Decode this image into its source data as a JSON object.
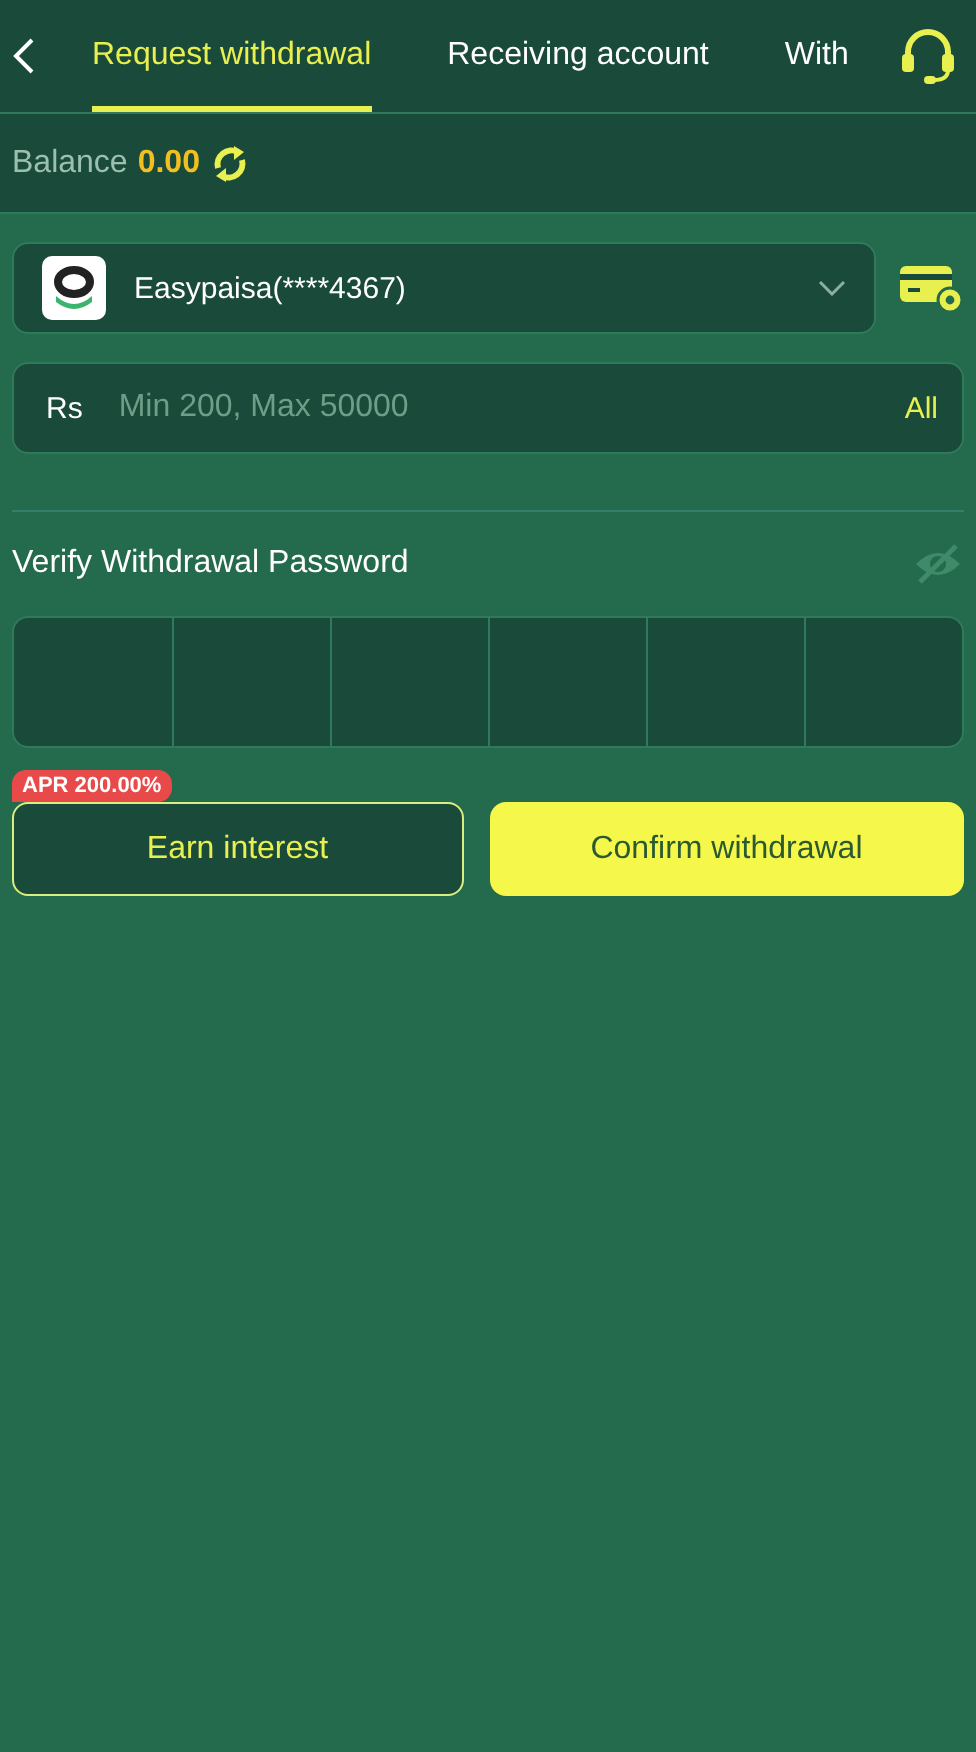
{
  "header": {
    "tabs": [
      {
        "label": "Request withdrawal",
        "selected": true
      },
      {
        "label": "Receiving account",
        "selected": false
      },
      {
        "label": "With",
        "selected": false
      }
    ]
  },
  "balance": {
    "label": "Balance",
    "amount": "0.00"
  },
  "account": {
    "name": "Easypaisa(****4367)"
  },
  "amount_field": {
    "currency": "Rs",
    "placeholder": "Min 200, Max 50000",
    "all_label": "All"
  },
  "password": {
    "label": "Verify Withdrawal Password",
    "visible": false,
    "cells": [
      {
        "filled": false
      },
      {
        "filled": false
      },
      {
        "filled": false
      },
      {
        "filled": false
      },
      {
        "filled": false
      },
      {
        "filled": false
      }
    ]
  },
  "buttons": {
    "earn": {
      "label": "Earn interest",
      "badge": "APR 200.00%"
    },
    "confirm": {
      "label": "Confirm withdrawal"
    }
  }
}
